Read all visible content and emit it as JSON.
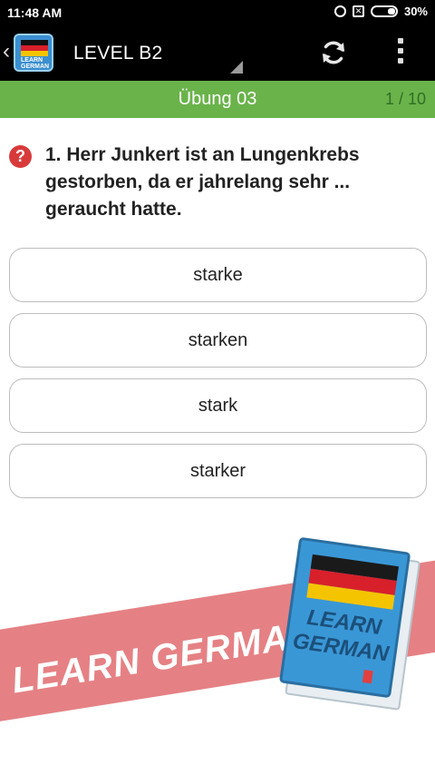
{
  "status_bar": {
    "time": "11:48 AM",
    "sim_label": "✕",
    "battery": "30%"
  },
  "app_bar": {
    "title": "LEVEL B2",
    "back_glyph": "‹",
    "logo_text": "LEARN GERMAN"
  },
  "lesson": {
    "title": "Übung 03",
    "progress": "1 / 10"
  },
  "question": {
    "help_glyph": "?",
    "text": "1. Herr Junkert ist an Lungenkrebs gestorben, da er jahrelang sehr ... geraucht hatte."
  },
  "answers": [
    "starke",
    "starken",
    "stark",
    "starker"
  ],
  "promo": {
    "banner_text": "LEARN GERMAN",
    "book_word1": "LEARN",
    "book_word2": "GERMAN"
  },
  "colors": {
    "lesson_bar": "#6ab34a",
    "help_icon": "#d83a3a",
    "banner": "#e3767a"
  }
}
